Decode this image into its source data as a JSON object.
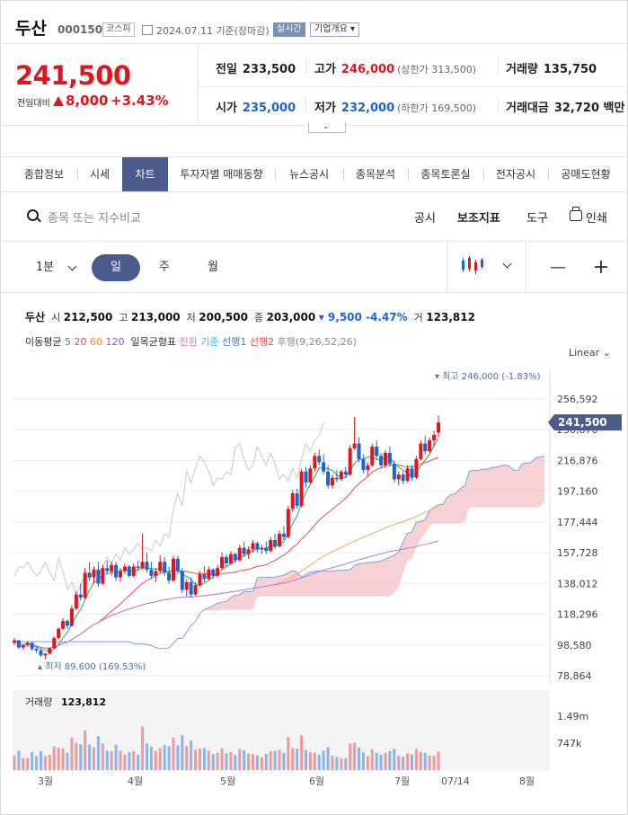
{
  "header": {
    "name": "두산",
    "code": "000150",
    "market": "코스피",
    "date": "2024.07.11 기준(장마감)",
    "realtime": "실시간",
    "company_info": "기업개요 ▾"
  },
  "price": {
    "current": "241,500",
    "change_label": "전일대비",
    "change": "8,000",
    "change_pct": "+3.43%"
  },
  "quote": {
    "prev_label": "전일",
    "prev": "233,500",
    "high_label": "고가",
    "high": "246,000",
    "upper_limit": "(상한가 313,500)",
    "volume_label": "거래량",
    "volume": "135,750",
    "open_label": "시가",
    "open": "235,000",
    "low_label": "저가",
    "low": "232,000",
    "lower_limit": "(하한가 169,500)",
    "amount_label": "거래대금",
    "amount": "32,720 백만"
  },
  "tabs": [
    "종합정보",
    "시세",
    "차트",
    "투자자별 매매동향",
    "뉴스공시",
    "종목분석",
    "종목토론실",
    "전자공시",
    "공매도현황"
  ],
  "toolbar": {
    "search_placeholder": "종목 또는 지수비교",
    "notice": "공시",
    "indicator": "보조지표",
    "tools": "도구",
    "print": "인쇄"
  },
  "periods": {
    "minute": "1분",
    "day": "일",
    "week": "주",
    "month": "월",
    "minus": "—",
    "plus": "+"
  },
  "info": {
    "name": "두산",
    "open_label": "시",
    "open": "212,500",
    "high_label": "고",
    "high": "213,000",
    "low_label": "저",
    "low": "200,500",
    "close_label": "종",
    "close": "203,000",
    "change": "▾ 9,500 -4.47%",
    "vol_label": "거",
    "vol": "123,812"
  },
  "indicators": {
    "ma_label": "이동평균",
    "ma5": "5",
    "ma20": "20",
    "ma60": "60",
    "ma120": "120",
    "ichimoku_label": "일목균형표",
    "conv": "전환",
    "base": "기준",
    "span1": "선행1",
    "span2": "선행2",
    "lag": "후행(9,26,52,26)"
  },
  "chart_data": {
    "type": "candlestick",
    "scale_label": "Linear",
    "y_ticks": [
      "256,592",
      "236,876",
      "216,876",
      "197,160",
      "177,444",
      "157,728",
      "138,012",
      "118,296",
      "98,580",
      "78,864"
    ],
    "current_price_tag": "241,500",
    "max_label": "▾ 최고 246,000 (-1.83%)",
    "min_label": "▴ 최저 89,600 (169.53%)",
    "volume_label": "거래량",
    "volume_value": "123,812",
    "volume_ticks": [
      "1.49m",
      "747k"
    ],
    "x_ticks": [
      "3월",
      "4월",
      "5월",
      "6월",
      "7월",
      "07/14",
      "8월"
    ],
    "candles": [
      [
        100000,
        103000,
        98500,
        101500
      ],
      [
        101500,
        102000,
        96000,
        97000
      ],
      [
        97000,
        99000,
        95500,
        98500
      ],
      [
        98500,
        101000,
        97500,
        100000
      ],
      [
        100000,
        100500,
        95000,
        96000
      ],
      [
        96000,
        97500,
        93500,
        95000
      ],
      [
        95000,
        96500,
        91000,
        92000
      ],
      [
        92000,
        93500,
        89600,
        93000
      ],
      [
        93000,
        97000,
        92500,
        96500
      ],
      [
        96500,
        104000,
        96000,
        103000
      ],
      [
        103000,
        110000,
        102000,
        109000
      ],
      [
        109000,
        116000,
        108000,
        114000
      ],
      [
        114000,
        115000,
        109000,
        111000
      ],
      [
        111000,
        124000,
        110500,
        122000
      ],
      [
        122000,
        133000,
        121000,
        131000
      ],
      [
        131000,
        138000,
        127000,
        129000
      ],
      [
        129000,
        148000,
        128000,
        145000
      ],
      [
        145000,
        152000,
        140000,
        142000
      ],
      [
        142000,
        149000,
        138000,
        147000
      ],
      [
        147000,
        152000,
        136000,
        138000
      ],
      [
        138000,
        150000,
        137000,
        148000
      ],
      [
        148000,
        153000,
        144000,
        146000
      ],
      [
        146000,
        152000,
        143000,
        150000
      ],
      [
        150000,
        152000,
        140000,
        142000
      ],
      [
        142000,
        148000,
        139000,
        146000
      ],
      [
        146000,
        151000,
        144000,
        149000
      ],
      [
        149000,
        150000,
        142000,
        143000
      ],
      [
        143000,
        151000,
        142000,
        149000
      ],
      [
        149000,
        153000,
        146000,
        148000
      ],
      [
        148000,
        170000,
        147000,
        152000
      ],
      [
        152000,
        158000,
        145000,
        147000
      ],
      [
        147000,
        152000,
        141000,
        143000
      ],
      [
        143000,
        148000,
        139000,
        146000
      ],
      [
        146000,
        156000,
        145000,
        152000
      ],
      [
        152000,
        155000,
        143000,
        145000
      ],
      [
        145000,
        149000,
        138000,
        140000
      ],
      [
        140000,
        156000,
        139000,
        154000
      ],
      [
        154000,
        156000,
        144000,
        146000
      ],
      [
        146000,
        148000,
        132000,
        134000
      ],
      [
        134000,
        141000,
        130000,
        139000
      ],
      [
        139000,
        142000,
        129000,
        131000
      ],
      [
        131000,
        139000,
        130000,
        137000
      ],
      [
        137000,
        146000,
        136000,
        144000
      ],
      [
        144000,
        149000,
        139000,
        141000
      ],
      [
        141000,
        149000,
        140000,
        147000
      ],
      [
        147000,
        148000,
        141000,
        143000
      ],
      [
        143000,
        150000,
        142000,
        148000
      ],
      [
        148000,
        158000,
        147000,
        155000
      ],
      [
        155000,
        157000,
        149000,
        151000
      ],
      [
        151000,
        159000,
        150000,
        157000
      ],
      [
        157000,
        158000,
        151000,
        153000
      ],
      [
        153000,
        163000,
        152000,
        161000
      ],
      [
        161000,
        165000,
        155000,
        157000
      ],
      [
        157000,
        162000,
        154000,
        160000
      ],
      [
        160000,
        166000,
        158000,
        164000
      ],
      [
        164000,
        165000,
        158000,
        160000
      ],
      [
        160000,
        163000,
        157000,
        161000
      ],
      [
        161000,
        165000,
        157000,
        159000
      ],
      [
        159000,
        168000,
        158000,
        166000
      ],
      [
        166000,
        170000,
        160000,
        162000
      ],
      [
        162000,
        172000,
        161000,
        170000
      ],
      [
        170000,
        175000,
        166000,
        168000
      ],
      [
        168000,
        188000,
        167000,
        186000
      ],
      [
        186000,
        198000,
        184000,
        196000
      ],
      [
        196000,
        199000,
        186000,
        188000
      ],
      [
        188000,
        212000,
        187000,
        210000
      ],
      [
        210000,
        213000,
        200000,
        203000
      ],
      [
        203000,
        214000,
        202000,
        212000
      ],
      [
        212000,
        222000,
        210000,
        220000
      ],
      [
        220000,
        224000,
        214000,
        216000
      ],
      [
        216000,
        221000,
        208000,
        210000
      ],
      [
        210000,
        214000,
        199000,
        201000
      ],
      [
        201000,
        208000,
        199000,
        206000
      ],
      [
        206000,
        211000,
        203000,
        205000
      ],
      [
        205000,
        211000,
        204000,
        210000
      ],
      [
        210000,
        213000,
        206000,
        208000
      ],
      [
        208000,
        227000,
        207000,
        225000
      ],
      [
        225000,
        245000,
        224000,
        228000
      ],
      [
        228000,
        232000,
        216000,
        218000
      ],
      [
        218000,
        221000,
        209000,
        211000
      ],
      [
        211000,
        216000,
        207000,
        214000
      ],
      [
        214000,
        228000,
        213000,
        226000
      ],
      [
        226000,
        230000,
        218000,
        220000
      ],
      [
        220000,
        222000,
        212000,
        214000
      ],
      [
        214000,
        224000,
        212000,
        222000
      ],
      [
        222000,
        226000,
        213000,
        215000
      ],
      [
        215000,
        217000,
        203000,
        205000
      ],
      [
        205000,
        210000,
        201000,
        208000
      ],
      [
        208000,
        210000,
        202000,
        204000
      ],
      [
        204000,
        214000,
        203000,
        212000
      ],
      [
        212000,
        214000,
        204000,
        206000
      ],
      [
        206000,
        220000,
        205000,
        218000
      ],
      [
        218000,
        230000,
        217000,
        228000
      ],
      [
        228000,
        233000,
        221000,
        223000
      ],
      [
        223000,
        232000,
        222000,
        230000
      ],
      [
        230000,
        236000,
        226000,
        233500
      ],
      [
        235000,
        246000,
        232000,
        241500
      ]
    ]
  }
}
